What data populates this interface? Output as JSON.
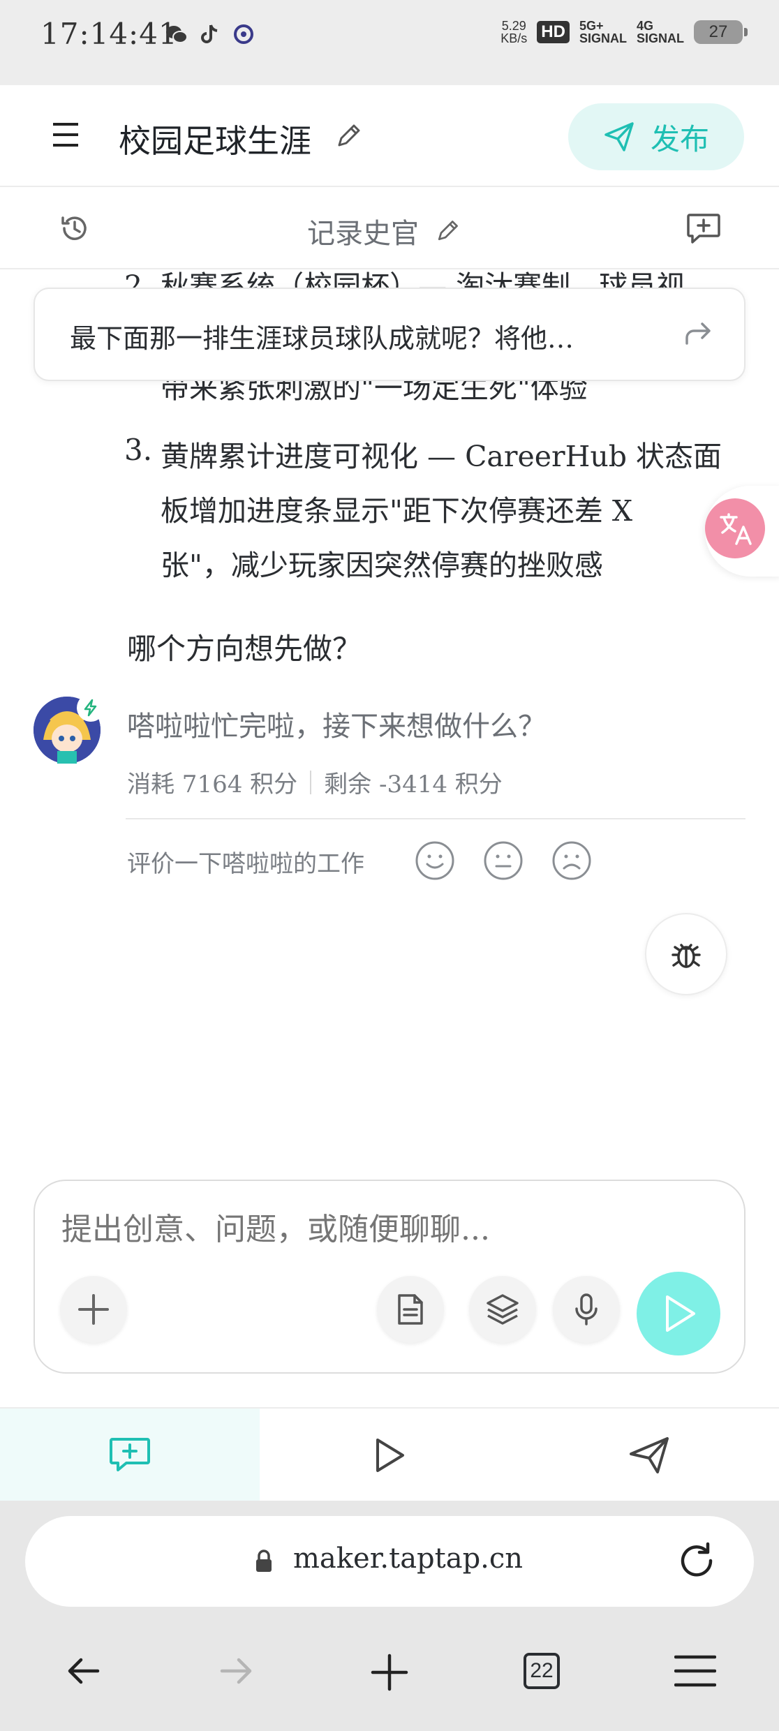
{
  "status_bar": {
    "time": "17:14:41",
    "net_speed_value": "5.29",
    "net_speed_unit": "KB/s",
    "hd": "HD",
    "signal_1_top": "5G+",
    "signal_1_bottom": "SIGNAL",
    "signal_2_top": "4G",
    "signal_2_bottom": "SIGNAL",
    "battery": "27"
  },
  "header": {
    "project_title": "校园足球生涯",
    "publish_label": "发布"
  },
  "subbar": {
    "agent_name": "记录史官"
  },
  "conversation": {
    "peek_line": "2. 秋赛系统（校园杯）— 淘汰赛制、球员视",
    "pinned_prompt": "最下面那一排生涯球员球队成就呢？将他…",
    "item2_tail": "带来紧张刺激的\"一场定生死\"体验",
    "item3_number": "3.",
    "item3_lines": [
      "黄牌累计进度可视化 — CareerHub 状态面",
      "板增加进度条显示\"距下次停赛还差 X",
      "张\"，减少玩家因突然停赛的挫败感"
    ],
    "question": "哪个方向想先做？",
    "bot_message": "嗒啦啦忙完啦，接下来想做什么？",
    "consumed": "消耗 7164 积分",
    "remaining": "剩余 -3414 积分",
    "rating_label": "评价一下嗒啦啦的工作"
  },
  "composer": {
    "placeholder": "提出创意、问题，或随便聊聊..."
  },
  "tabbar": {
    "active": "chat"
  },
  "browser": {
    "url": "maker.taptap.cn",
    "tab_count": "22"
  },
  "colors": {
    "accent": "#1fbfb3",
    "accent_light": "#e2f7f5",
    "send_button": "#7ff0e6",
    "translate_fab": "#f28fa8"
  },
  "icons": [
    "menu-icon",
    "pencil-icon",
    "send-icon",
    "history-icon",
    "new-chat-icon",
    "forward-icon",
    "translate-icon",
    "bug-icon",
    "smile-icon",
    "neutral-icon",
    "sad-icon",
    "plus-icon",
    "document-icon",
    "layers-icon",
    "microphone-icon",
    "play-icon",
    "lock-icon",
    "reload-icon",
    "back-arrow-icon",
    "forward-arrow-icon",
    "hamburger-icon"
  ]
}
